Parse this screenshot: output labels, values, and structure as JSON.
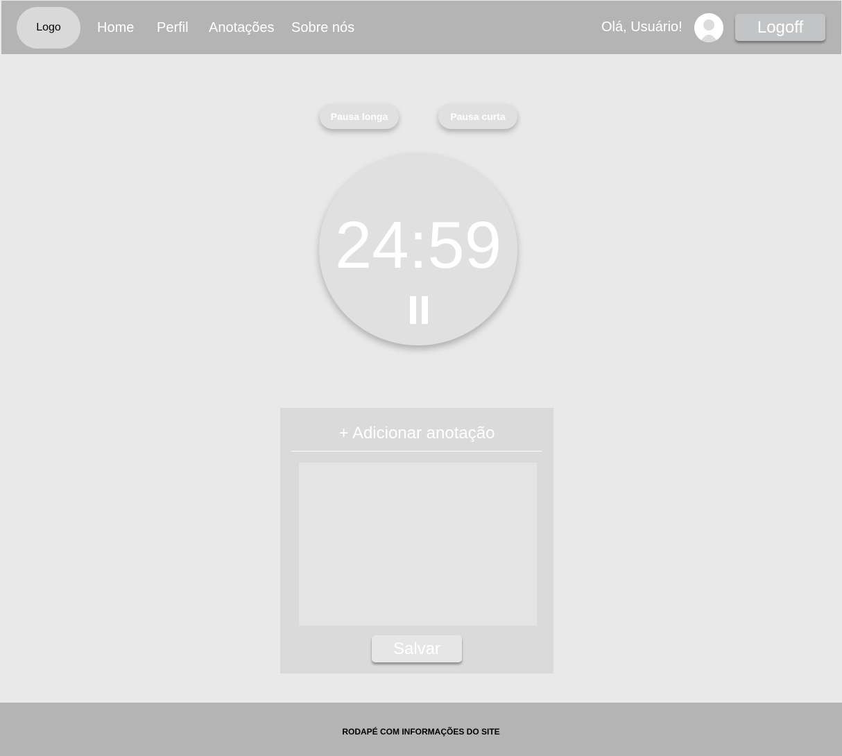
{
  "header": {
    "logo": "Logo",
    "nav": [
      {
        "label": "Home"
      },
      {
        "label": "Perfil"
      },
      {
        "label": "Anotações"
      },
      {
        "label": "Sobre nós"
      }
    ],
    "greeting": "Olá, Usuário!",
    "logoff_label": "Logoff"
  },
  "pomodoro": {
    "long_break_label": "Pausa longa",
    "short_break_label": "Pausa curta",
    "time": "24:59",
    "state_icon": "pause-icon"
  },
  "notes": {
    "title": "+ Adicionar anotação",
    "content": "",
    "save_label": "Salvar"
  },
  "footer": {
    "text": "RODAPÉ COM INFORMAÇÕES DO SITE"
  },
  "colors": {
    "header_bg": "#b4b4b4",
    "page_bg": "#e9e9e9",
    "panel_bg": "#dadada",
    "text_light": "#ffffff"
  }
}
